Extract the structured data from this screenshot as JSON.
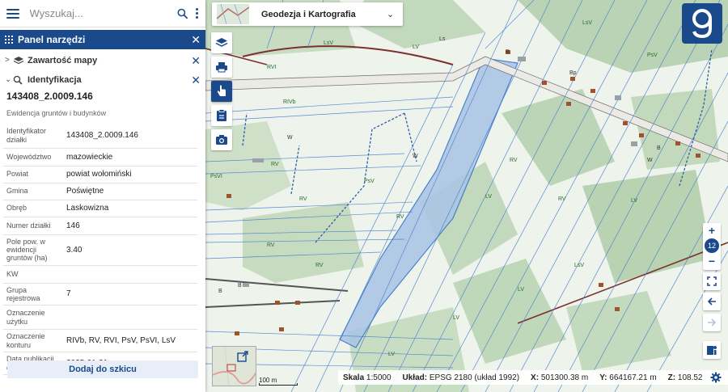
{
  "search": {
    "placeholder": "Wyszukaj..."
  },
  "panel": {
    "title": "Panel narzędzi",
    "sections": {
      "map_content": "Zawartość mapy",
      "identification": "Identyfikacja"
    },
    "parcel_id": "143408_2.0009.146",
    "source": "Ewidencja gruntów i budynków",
    "attributes": [
      {
        "key": "Identyfikator działki",
        "value": "143408_2.0009.146"
      },
      {
        "key": "Województwo",
        "value": "mazowieckie"
      },
      {
        "key": "Powiat",
        "value": "powiat wołomiński"
      },
      {
        "key": "Gmina",
        "value": "Poświętne"
      },
      {
        "key": "Obręb",
        "value": "Laskowizna"
      },
      {
        "key": "Numer działki",
        "value": "146"
      },
      {
        "key": "Pole pow. w ewidencji gruntów (ha)",
        "value": "3.40"
      },
      {
        "key": "KW",
        "value": ""
      },
      {
        "key": "Grupa rejestrowa",
        "value": "7"
      },
      {
        "key": "Oznaczenie użytku",
        "value": ""
      },
      {
        "key": "Oznaczenie konturu",
        "value": "RIVb, RV, RVI, PsV, PsVI, LsV"
      },
      {
        "key": "Data publikacji danych",
        "value": "2025-01-21"
      }
    ],
    "add_button": "Dodaj do szkicu"
  },
  "layer_selector": {
    "name": "Geodezja i Kartografia"
  },
  "zoom": {
    "level": "12"
  },
  "scalebar": {
    "label": "100 m"
  },
  "status": {
    "scale_label": "Skala",
    "scale_value": "1:5000",
    "crs_label": "Układ:",
    "crs_value": "EPSG 2180 (układ 1992)",
    "x_label": "X:",
    "x_value": "501300.38 m",
    "y_label": "Y:",
    "y_value": "664167.21 m",
    "z_label": "Z:",
    "z_value": "108.52"
  },
  "colors": {
    "accent": "#1a4a8c",
    "map_bg": "#eef3ec",
    "forest": "#b9d3b4",
    "selection": "#a8c4e6"
  }
}
